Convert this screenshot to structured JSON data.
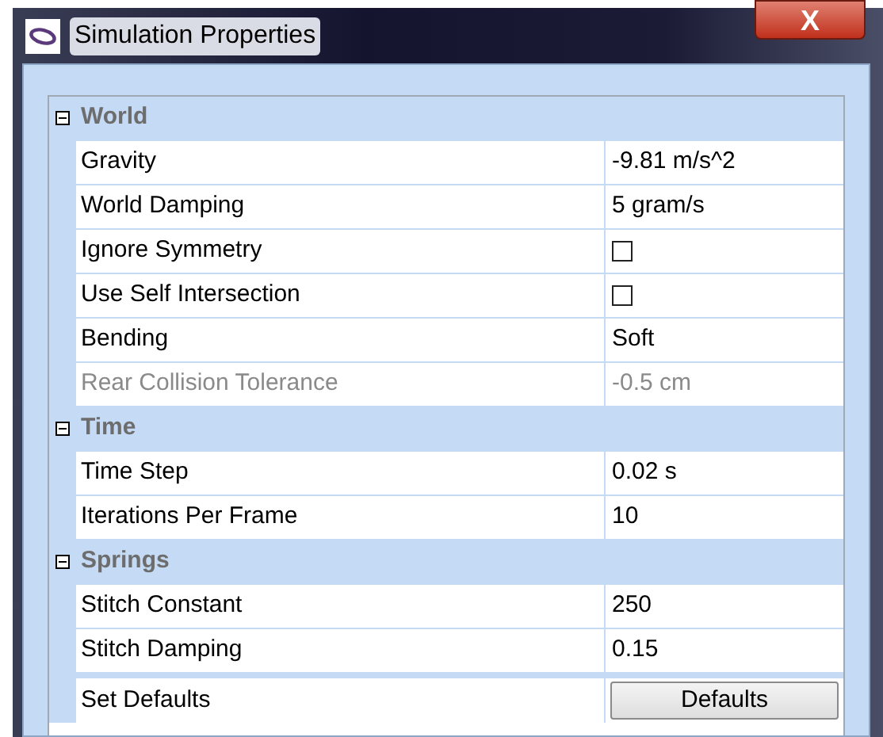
{
  "window": {
    "title": "Simulation Properties",
    "close": "X"
  },
  "groups": [
    {
      "title": "World",
      "expanded": true,
      "rows": [
        {
          "kind": "text",
          "label": "Gravity",
          "value": "-9.81 m/s^2",
          "disabled": false
        },
        {
          "kind": "text",
          "label": "World Damping",
          "value": "5 gram/s",
          "disabled": false
        },
        {
          "kind": "checkbox",
          "label": "Ignore Symmetry",
          "checked": false,
          "disabled": false
        },
        {
          "kind": "checkbox",
          "label": "Use Self Intersection",
          "checked": false,
          "disabled": false
        },
        {
          "kind": "text",
          "label": "Bending",
          "value": "Soft",
          "disabled": false
        },
        {
          "kind": "text",
          "label": "Rear Collision Tolerance",
          "value": "-0.5 cm",
          "disabled": true
        }
      ]
    },
    {
      "title": "Time",
      "expanded": true,
      "rows": [
        {
          "kind": "text",
          "label": "Time Step",
          "value": "0.02 s",
          "disabled": false
        },
        {
          "kind": "text",
          "label": "Iterations Per Frame",
          "value": "10",
          "disabled": false
        }
      ]
    },
    {
      "title": "Springs",
      "expanded": true,
      "rows": [
        {
          "kind": "text",
          "label": "Stitch Constant",
          "value": "250",
          "disabled": false
        },
        {
          "kind": "text",
          "label": "Stitch Damping",
          "value": "0.15",
          "disabled": false
        }
      ]
    }
  ],
  "footer": {
    "label": "Set Defaults",
    "button": "Defaults"
  }
}
